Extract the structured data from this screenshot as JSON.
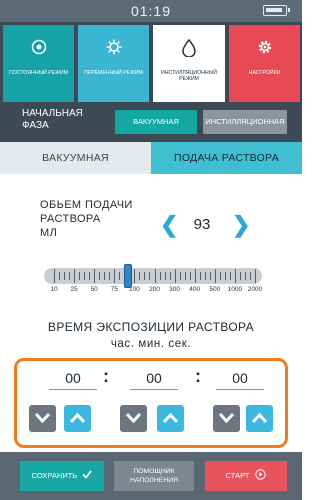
{
  "status_bar": {
    "time": "01:19"
  },
  "mode_tiles": [
    {
      "label": "ПОСТОЯННЫЙ РЕЖИМ",
      "icon": "target-icon",
      "color": "#17a2a7"
    },
    {
      "label": "ПЕРЕМЕННЫЙ РЕЖИМ",
      "icon": "sun-gear-icon",
      "color": "#3ab6d2"
    },
    {
      "label": "ИНСТИЛЛЯЦИОННЫЙ РЕЖИМ",
      "icon": "droplet-icon",
      "color": "#ffffff"
    },
    {
      "label": "НАСТРОЙКИ",
      "icon": "gear-icon",
      "color": "#e84a55"
    }
  ],
  "initial_phase": {
    "title_line1": "НАЧАЛЬНАЯ",
    "title_line2": "ФАЗА",
    "vacuum_label": "ВАКУУМНАЯ",
    "instill_label": "ИНСТИЛЛЯЦИОННАЯ"
  },
  "tabs": {
    "vacuum": "ВАКУУМНАЯ",
    "solution": "ПОДАЧА РАСТВОРА"
  },
  "volume": {
    "label_line1": "ОБЬЕМ ПОДАЧИ",
    "label_line2": "РАСТВОРА",
    "label_line3": "МЛ",
    "value": "93",
    "scale_labels": [
      "10",
      "25",
      "50",
      "75",
      "100",
      "200",
      "300",
      "400",
      "500",
      "1000",
      "2000"
    ]
  },
  "exposure": {
    "title": "ВРЕМЯ ЭКСПОЗИЦИИ РАСТВОРА",
    "units": "час. мин. сек.",
    "hours": "00",
    "minutes": "00",
    "seconds": "00",
    "separator": ":"
  },
  "bottom_bar": {
    "save": "СОХРАНИТЬ",
    "help_line1": "ПОМОЩНИК",
    "help_line2": "НАПОЛНЕНИЯ",
    "start": "СТАРТ"
  },
  "colors": {
    "accent_orange": "#f07a1c",
    "teal": "#17a8a5",
    "red": "#e8535c",
    "blue": "#3bb7e0"
  }
}
